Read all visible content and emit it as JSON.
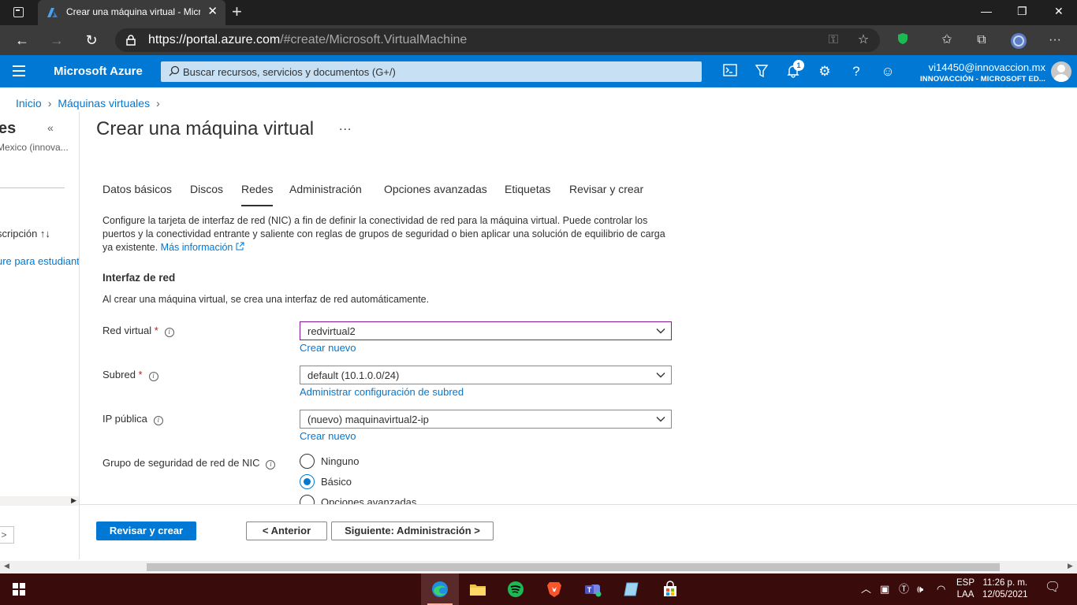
{
  "browser": {
    "tab_title": "Crear una máquina virtual - Microsoft Azure",
    "url_host": "https://portal.azure.com",
    "url_rest": "/#create/Microsoft.VirtualMachine"
  },
  "azure": {
    "brand": "Microsoft Azure",
    "search_placeholder": "Buscar recursos, servicios y documentos (G+/)",
    "notification_count": "1",
    "account_email": "vi14450@innovaccion.mx",
    "account_tenant": "INNOVACCIÓN - MICROSOFT ED...",
    "accent_color": "#0078d4"
  },
  "breadcrumb": {
    "items": [
      "Inicio",
      "Máquinas virtuales"
    ]
  },
  "left_blade": {
    "title_fragment": "es",
    "subtitle_fragment": "Mexico (innova...",
    "column_header_fragment": "scripción ↑↓",
    "row_fragment": "ure para estudiant",
    "button_fragment": ">"
  },
  "page": {
    "title": "Crear una máquina virtual",
    "more_label": "...",
    "tabs": [
      {
        "label": "Datos básicos"
      },
      {
        "label": "Discos"
      },
      {
        "label": "Redes",
        "active": true
      },
      {
        "label": "Administración"
      },
      {
        "label": "Opciones avanzadas"
      },
      {
        "label": "Etiquetas"
      },
      {
        "label": "Revisar y crear"
      }
    ],
    "description": "Configure la tarjeta de interfaz de red (NIC) a fin de definir la conectividad de red para la máquina virtual. Puede controlar los puertos y la conectividad entrante y saliente con reglas de grupos de seguridad o bien aplicar una solución de equilibrio de carga ya existente.",
    "more_info_link": "Más información",
    "section_title": "Interfaz de red",
    "section_subtitle": "Al crear una máquina virtual, se crea una interfaz de red automáticamente.",
    "fields": {
      "virtual_network": {
        "label": "Red virtual",
        "required": "*",
        "value": "redvirtual2",
        "link": "Crear nuevo"
      },
      "subnet": {
        "label": "Subred",
        "required": "*",
        "value": "default (10.1.0.0/24)",
        "link": "Administrar configuración de subred"
      },
      "public_ip": {
        "label": "IP pública",
        "value": "(nuevo) maquinavirtual2-ip",
        "link": "Crear nuevo"
      },
      "nsg": {
        "label": "Grupo de seguridad de red de NIC",
        "options": [
          {
            "label": "Ninguno",
            "selected": false
          },
          {
            "label": "Básico",
            "selected": true
          },
          {
            "label": "Opciones avanzadas",
            "selected": false
          }
        ]
      }
    }
  },
  "footer": {
    "review_create": "Revisar y crear",
    "previous": "< Anterior",
    "next": "Siguiente: Administración >"
  },
  "taskbar": {
    "apps": [
      "edge-icon",
      "file-explorer-icon",
      "spotify-icon",
      "brave-icon",
      "teams-icon",
      "notepad-icon",
      "store-icon"
    ],
    "language_line1": "ESP",
    "language_line2": "LAA",
    "time": "11:26 p. m.",
    "date": "12/05/2021"
  }
}
